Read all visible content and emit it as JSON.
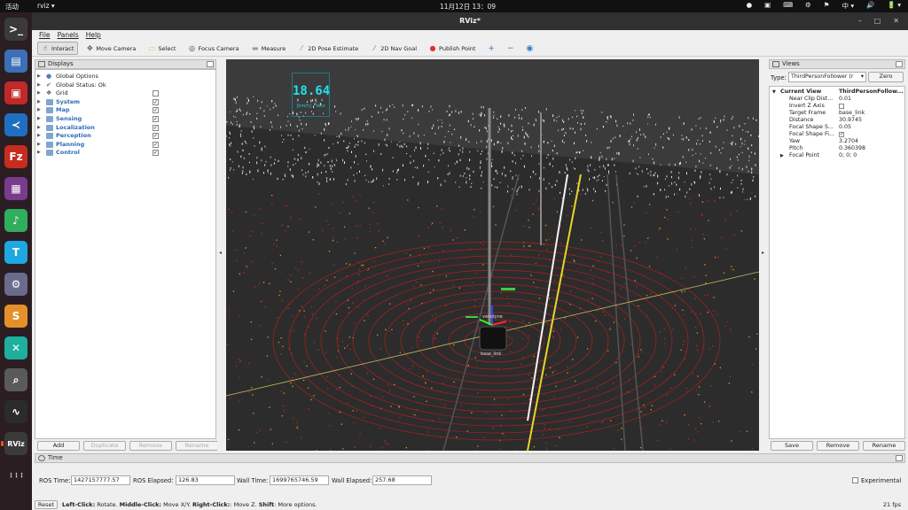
{
  "topbar": {
    "activities": "活动",
    "app_menu": "rviz ▾",
    "clock": "11月12日  13：09",
    "tray": [
      "中 ▾",
      "🔊",
      "🔋 ▾"
    ]
  },
  "dock": {
    "items": [
      {
        "name": "terminal",
        "glyph": ">_",
        "color": "#3a3a3a"
      },
      {
        "name": "system-monitor",
        "glyph": "▤",
        "color": "#3d6fb6"
      },
      {
        "name": "text-editor",
        "glyph": "▣",
        "color": "#c0282a"
      },
      {
        "name": "vscode",
        "glyph": "≺",
        "color": "#1f6fc1"
      },
      {
        "name": "filezilla",
        "glyph": "Fz",
        "color": "#c62d1f"
      },
      {
        "name": "screen-recorder",
        "glyph": "▦",
        "color": "#7a3b8c"
      },
      {
        "name": "music-player",
        "glyph": "♪",
        "color": "#2fae5d"
      },
      {
        "name": "feishu",
        "glyph": "T",
        "color": "#1ea7e1"
      },
      {
        "name": "virtualbox",
        "glyph": "⚙",
        "color": "#6b6b8c"
      },
      {
        "name": "sublime-text",
        "glyph": "S",
        "color": "#e4912c"
      },
      {
        "name": "remote-desktop",
        "glyph": "✕",
        "color": "#1eaf9f"
      },
      {
        "name": "search-tool",
        "glyph": "⌕",
        "color": "#5a5a5a"
      },
      {
        "name": "waveform-app",
        "glyph": "∿",
        "color": "#2b2b2b"
      },
      {
        "name": "rviz",
        "glyph": "RViz",
        "color": "#3a3a3a"
      },
      {
        "name": "show-apps",
        "glyph": "⋮⋮⋮",
        "color": "transparent"
      }
    ]
  },
  "window": {
    "title": "RViz*"
  },
  "menu": [
    "File",
    "Panels",
    "Help"
  ],
  "toolbar": {
    "tools": [
      {
        "name": "interact",
        "label": "Interact",
        "icon": "hand-icon",
        "glyph": "☝",
        "active": true
      },
      {
        "name": "move-camera",
        "label": "Move Camera",
        "icon": "move-camera-icon",
        "glyph": "✥",
        "active": false
      },
      {
        "name": "select",
        "label": "Select",
        "icon": "select-icon",
        "glyph": "▭",
        "active": false
      },
      {
        "name": "focus-camera",
        "label": "Focus Camera",
        "icon": "focus-camera-icon",
        "glyph": "◎",
        "active": false
      },
      {
        "name": "measure",
        "label": "Measure",
        "icon": "ruler-icon",
        "glyph": "▬",
        "active": false
      },
      {
        "name": "2d-pose-estimate",
        "label": "2D Pose Estimate",
        "icon": "pose-arrow-icon",
        "glyph": "⁄",
        "active": false
      },
      {
        "name": "2d-nav-goal",
        "label": "2D Nav Goal",
        "icon": "nav-arrow-icon",
        "glyph": "⁄",
        "active": false
      },
      {
        "name": "publish-point",
        "label": "Publish Point",
        "icon": "map-pin-icon",
        "glyph": "●",
        "active": false
      }
    ]
  },
  "displays": {
    "title": "Displays",
    "rows": [
      {
        "label": "Global Options",
        "icon": "globe-icon",
        "folder": false,
        "bold": false,
        "check": null
      },
      {
        "label": "Global Status: Ok",
        "icon": "checkmark-icon",
        "folder": false,
        "bold": false,
        "check": null
      },
      {
        "label": "Grid",
        "icon": "grid-icon",
        "folder": false,
        "bold": false,
        "check": false
      },
      {
        "label": "System",
        "icon": "folder-icon",
        "folder": true,
        "bold": true,
        "check": true
      },
      {
        "label": "Map",
        "icon": "folder-icon",
        "folder": true,
        "bold": true,
        "check": true
      },
      {
        "label": "Sensing",
        "icon": "folder-icon",
        "folder": true,
        "bold": true,
        "check": true
      },
      {
        "label": "Localization",
        "icon": "folder-icon",
        "folder": true,
        "bold": true,
        "check": true
      },
      {
        "label": "Perception",
        "icon": "folder-icon",
        "folder": true,
        "bold": true,
        "check": true
      },
      {
        "label": "Planning",
        "icon": "folder-icon",
        "folder": true,
        "bold": true,
        "check": true
      },
      {
        "label": "Control",
        "icon": "folder-icon",
        "folder": true,
        "bold": true,
        "check": true
      }
    ],
    "buttons": [
      {
        "label": "Add",
        "enabled": true
      },
      {
        "label": "Duplicate",
        "enabled": false
      },
      {
        "label": "Remove",
        "enabled": false
      },
      {
        "label": "Rename",
        "enabled": false
      }
    ]
  },
  "viewport": {
    "speed_readout": "18.64",
    "speed_sublabel": "[km/h] - Velo",
    "vehicle_label": "velodyne",
    "base_label": "base_link"
  },
  "views": {
    "title": "Views",
    "type_label": "Type:",
    "type_value": "ThirdPersonFollower (r",
    "zero_label": "Zero",
    "header_key": "Current View",
    "header_value": "ThirdPersonFollow...",
    "properties": [
      {
        "key": "Near Clip Dist...",
        "value": "0.01"
      },
      {
        "key": "Invert Z Axis",
        "value": "",
        "check": false
      },
      {
        "key": "Target Frame",
        "value": "base_link"
      },
      {
        "key": "Distance",
        "value": "30.9745"
      },
      {
        "key": "Focal Shape S...",
        "value": "0.05"
      },
      {
        "key": "Focal Shape Fi...",
        "value": "",
        "check": true
      },
      {
        "key": "Yaw",
        "value": "3.2704"
      },
      {
        "key": "Pitch",
        "value": "0.360398"
      },
      {
        "key": "Focal Point",
        "value": "0; 0; 0",
        "expandable": true
      }
    ],
    "buttons": [
      "Save",
      "Remove",
      "Rename"
    ]
  },
  "time": {
    "title": "Time",
    "ros_time_label": "ROS Time:",
    "ros_time": "1427157777.57",
    "ros_elapsed_label": "ROS Elapsed:",
    "ros_elapsed": "126.83",
    "wall_time_label": "Wall Time:",
    "wall_time": "1699765746.59",
    "wall_elapsed_label": "Wall Elapsed:",
    "wall_elapsed": "257.68",
    "experimental_label": "Experimental"
  },
  "status": {
    "reset_label": "Reset",
    "hint_bold_1": "Left-Click:",
    "hint_1": " Rotate. ",
    "hint_bold_2": "Middle-Click:",
    "hint_2": " Move X/Y. ",
    "hint_bold_3": "Right-Click:",
    "hint_3": ": Move Z. ",
    "hint_bold_4": "Shift",
    "hint_4": ": More options.",
    "fps": "21 fps"
  }
}
